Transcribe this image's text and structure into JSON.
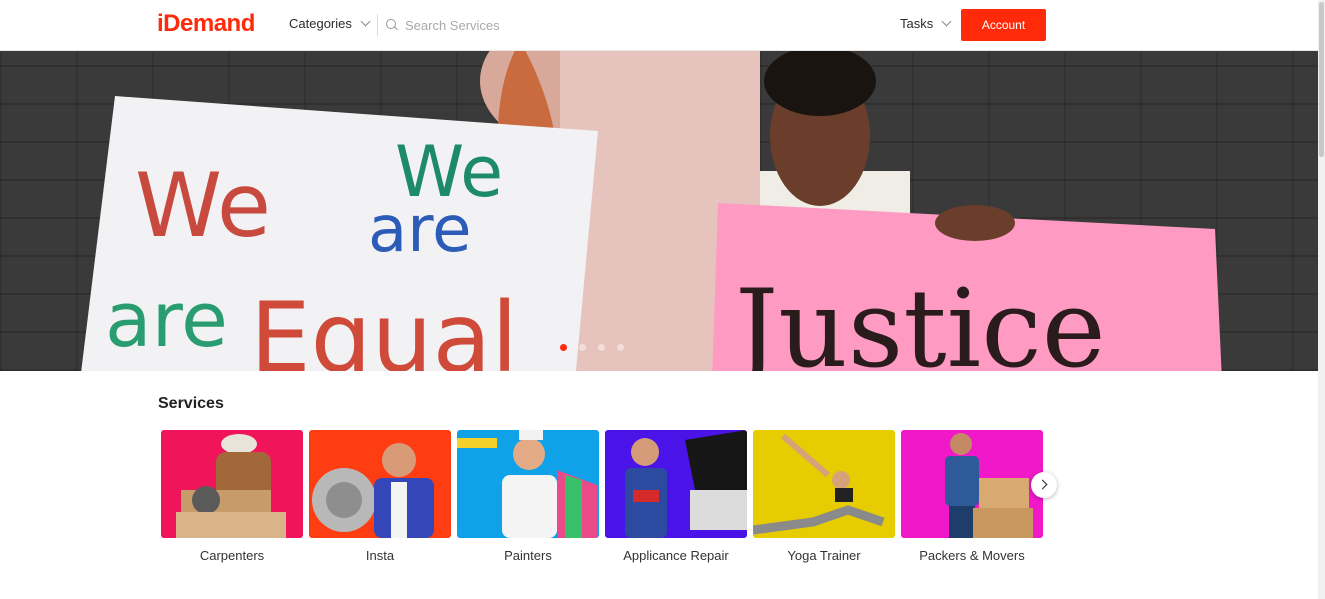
{
  "header": {
    "logo": "iDemand",
    "categories_label": "Categories",
    "search_placeholder": "Search Services",
    "tasks_label": "Tasks",
    "account_label": "Account"
  },
  "hero": {
    "sign_left_text_1": "We",
    "sign_left_text_2": "We",
    "sign_left_text_3": "are",
    "sign_left_text_4": "are",
    "sign_left_text_5": "Equal",
    "sign_right_text": "Justice",
    "slides_total": 4,
    "active_slide": 1
  },
  "services": {
    "title": "Services",
    "items": [
      {
        "label": "Carpenters",
        "bg": "#f0155a"
      },
      {
        "label": "Insta",
        "bg": "#ff3d12"
      },
      {
        "label": "Painters",
        "bg": "#10a2e8"
      },
      {
        "label": "Applicance Repair",
        "bg": "#4a14e8"
      },
      {
        "label": "Yoga Trainer",
        "bg": "#e6cc00"
      },
      {
        "label": "Packers & Movers",
        "bg": "#f018c8"
      }
    ]
  },
  "colors": {
    "brand": "#ff2a0a"
  }
}
